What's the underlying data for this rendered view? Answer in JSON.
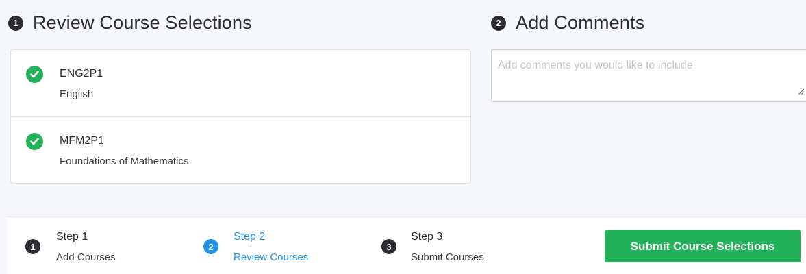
{
  "review_section": {
    "number": "1",
    "title": "Review Course Selections",
    "courses": [
      {
        "code": "ENG2P1",
        "name": "English",
        "status_icon": "check-circle-icon"
      },
      {
        "code": "MFM2P1",
        "name": "Foundations of Mathematics",
        "status_icon": "check-circle-icon"
      }
    ]
  },
  "comments_section": {
    "number": "2",
    "title": "Add Comments",
    "placeholder": "Add comments you would like to include",
    "value": ""
  },
  "steps": [
    {
      "number": "1",
      "title": "Step 1",
      "subtitle": "Add Courses",
      "active": false
    },
    {
      "number": "2",
      "title": "Step 2",
      "subtitle": "Review Courses",
      "active": true
    },
    {
      "number": "3",
      "title": "Step 3",
      "subtitle": "Submit Courses",
      "active": false
    }
  ],
  "submit_button": {
    "label": "Submit Course Selections"
  },
  "colors": {
    "accent_green": "#22b35a",
    "active_blue": "#1e95e8",
    "dark": "#2b2d33",
    "background": "#f6f7fb"
  }
}
